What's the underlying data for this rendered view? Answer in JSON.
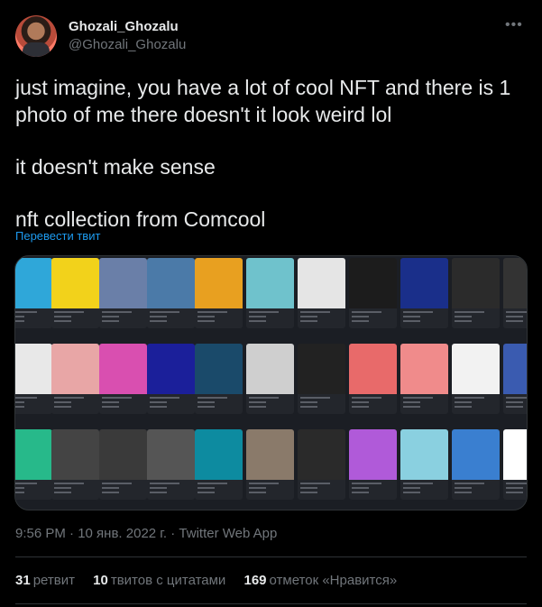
{
  "author": {
    "display_name": "Ghozali_Ghozalu",
    "handle": "@Ghozali_Ghozalu"
  },
  "more_icon": "more-horizontal-icon",
  "tweet": {
    "lines": [
      "just imagine, you have a lot of cool NFT and there is 1 photo of me there doesn't it look weird lol",
      "it doesn't make sense",
      "nft collection from Comcool"
    ],
    "translate_label": "Перевести твит"
  },
  "media": {
    "description_icon": "nft-collection-screenshot"
  },
  "meta": {
    "timestamp": "9:56 PM · 10 янв. 2022 г. · Twitter Web App"
  },
  "stats": {
    "retweets_count": "31",
    "retweets_label": "ретвит",
    "quotes_count": "10",
    "quotes_label": "твитов с цитатами",
    "likes_count": "169",
    "likes_label": "отметок «Нравится»"
  },
  "colors": {
    "background": "#000000",
    "text_primary": "#e7e9ea",
    "text_secondary": "#71767b",
    "link": "#1d9bf0",
    "border": "#2f3336"
  }
}
